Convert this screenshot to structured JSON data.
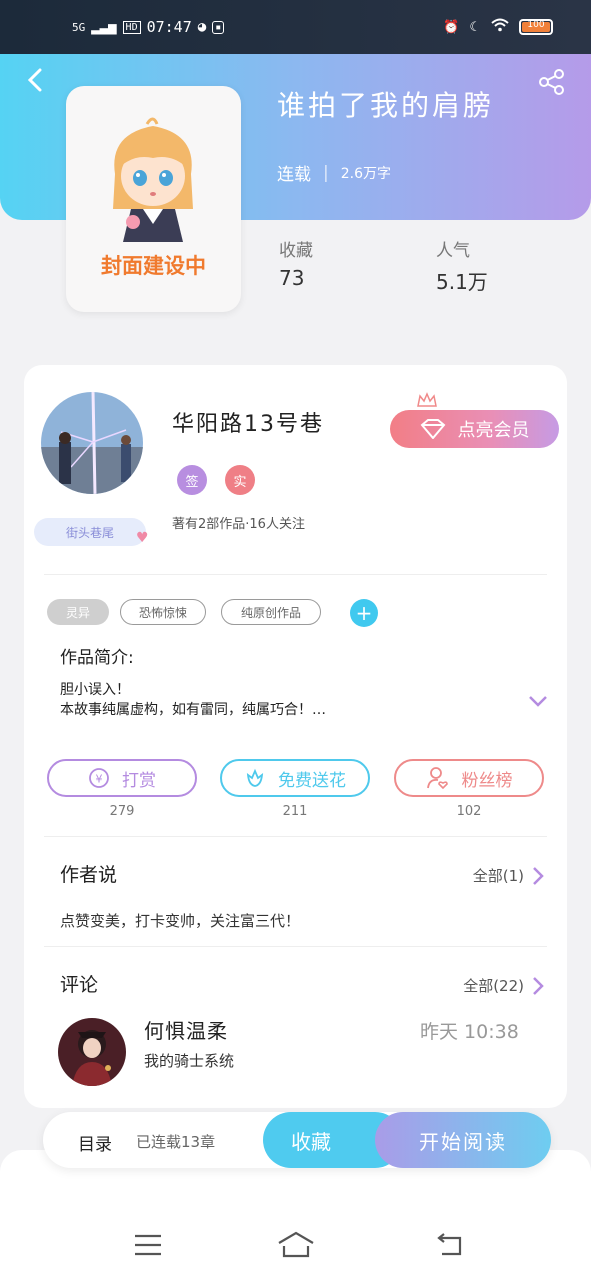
{
  "status_bar": {
    "network": "5G",
    "hd": "HD",
    "time": "07:47",
    "battery": "100"
  },
  "book": {
    "title": "谁拍了我的肩膀",
    "status": "连载",
    "separator": "|",
    "word_count": "2.6万字",
    "cover_label": "封面建设中",
    "favorites_label": "收藏",
    "favorites_value": "73",
    "popularity_label": "人气",
    "popularity_value": "5.1万"
  },
  "author": {
    "name": "华阳路13号巷",
    "badge_sign": "签",
    "badge_real": "实",
    "vip_button": "点亮会员",
    "stats": "著有2部作品·16人关注",
    "nameplate": "街头巷尾"
  },
  "tags": [
    "灵异",
    "恐怖惊悚",
    "纯原创作品"
  ],
  "tag_add": "+",
  "intro": {
    "title": "作品简介:",
    "text": "胆小误入！\n本故事纯属虚构，如有雷同，纯属巧合！…"
  },
  "actions": [
    {
      "label": "打赏",
      "count": "279",
      "color": "#b48be0",
      "icon": "yen-coin-icon"
    },
    {
      "label": "免费送花",
      "count": "211",
      "color": "#4fc9ec",
      "icon": "flower-icon"
    },
    {
      "label": "粉丝榜",
      "count": "102",
      "color": "#ee8a8a",
      "icon": "fan-user-icon"
    }
  ],
  "author_says": {
    "title": "作者说",
    "more": "全部(1)",
    "text": "点赞变美，打卡变帅，关注富三代！"
  },
  "comments": {
    "title": "评论",
    "more": "全部(22)",
    "items": [
      {
        "name": "何惧温柔",
        "time": "昨天 10:38",
        "text": "我的骑士系统"
      }
    ]
  },
  "bottom_bar": {
    "toc": "目录",
    "toc_count": "已连载13章",
    "favorite": "收藏",
    "start_reading": "开始阅读"
  },
  "colors": {
    "accent_blue": "#4fcbef",
    "accent_purple": "#b59be9",
    "cover_label": "#f07a2e"
  }
}
